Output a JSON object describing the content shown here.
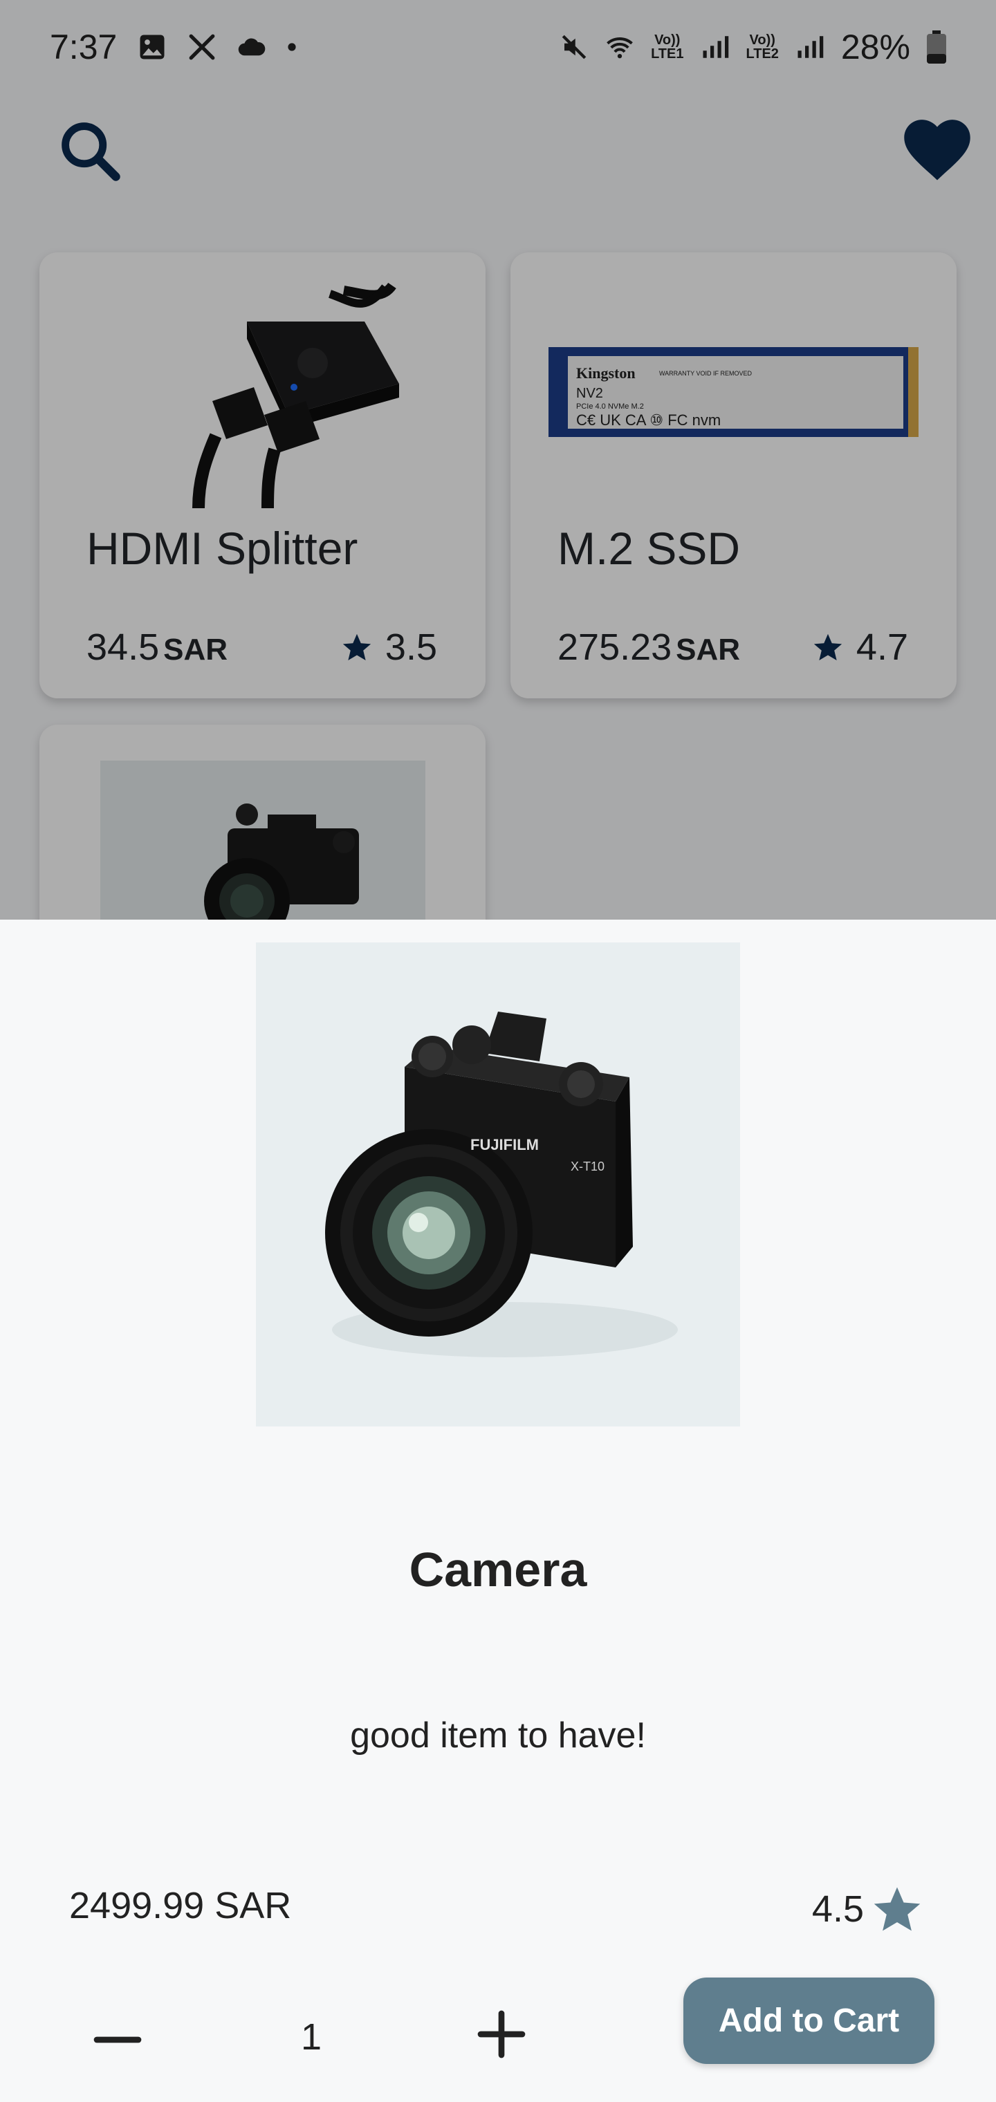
{
  "status_bar": {
    "time": "7:37",
    "battery": "28%",
    "sim1_label_top": "Vo))",
    "sim1_label_bottom": "LTE1",
    "sim2_label_top": "Vo))",
    "sim2_label_bottom": "LTE2",
    "icons": [
      "image-icon",
      "tools-icon",
      "cloud-icon",
      "dot-icon",
      "mute-icon",
      "wifi-icon",
      "signal-icon",
      "battery-icon"
    ]
  },
  "top_bar": {
    "icons": [
      "search-icon",
      "heart-icon"
    ]
  },
  "products": [
    {
      "title": "HDMI Splitter",
      "price": "34.5",
      "currency": "SAR",
      "rating": "3.5"
    },
    {
      "title": "M.2 SSD",
      "price": "275.23",
      "currency": "SAR",
      "rating": "4.7"
    },
    {
      "title": "Camera"
    }
  ],
  "ssd_label": {
    "brand": "Kingston",
    "model": "NV2",
    "warranty": "WARRANTY VOID IF REMOVED",
    "spec": "PCIe 4.0 NVMe M.2"
  },
  "camera_label": {
    "brand": "FUJIFILM",
    "model": "X-T10"
  },
  "detail": {
    "name": "Camera",
    "description": "good item to have!",
    "price": "2499.99 SAR",
    "rating": "4.5",
    "quantity": "1",
    "add_to_cart_label": "Add to Cart"
  },
  "colors": {
    "accent": "#0b2a4f",
    "button": "#5f7e8e",
    "scrim": "rgba(0,0,0,0.32)"
  }
}
